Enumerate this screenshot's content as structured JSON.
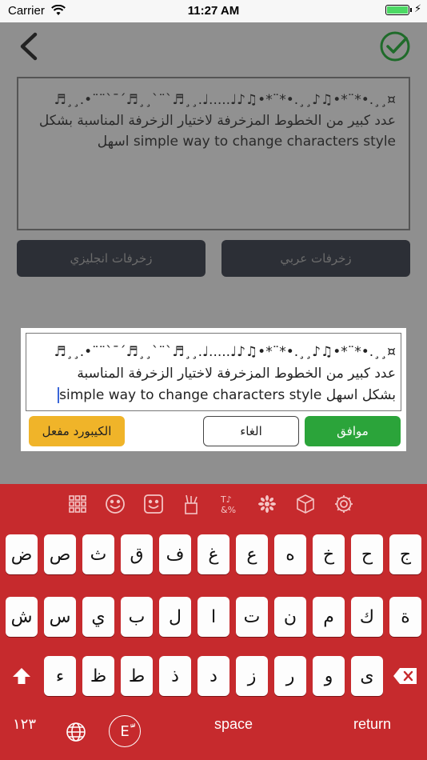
{
  "status": {
    "carrier": "Carrier",
    "time": "11:27 AM"
  },
  "colors": {
    "accent": "#2ba43a",
    "keyboard_bg": "#c62a2d",
    "badge": "#f0b429"
  },
  "preview": {
    "line1": "¤¸¸.•*¨*•♫♪¸¸.•*¨*•♫♪♩.....♩.¸¸♬`¨`¸¸♬´¯`¨¨•.¸¸♬",
    "line2": "عدد كبير من الخطوط المزخرفة لاختيار الزخرفة المناسبة بشكل",
    "line3": "simple way to change characters style اسهل"
  },
  "tabs": {
    "english": "زخرفات انجليزي",
    "arabic": "زخرفات عربي"
  },
  "dialog": {
    "line1": "¤¸¸.•*¨*•♫♪¸¸.•*¨*•♫♪♩.....♩.¸¸♬`¨`¸¸♬´¯`¨¨•.¸¸♬",
    "line2": "عدد كبير من الخطوط المزخرفة لاختيار الزخرفة المناسبة",
    "line3": "بشكل اسهل simple way to change characters style",
    "ok": "موافق",
    "cancel": "الغاء",
    "keyboard_on": "الكيبورد مفعل"
  },
  "toolbar_icons": [
    "grid-icon",
    "emoji-icon",
    "sticker-icon",
    "stationery-icon",
    "symbols-icon",
    "flower-icon",
    "cube-icon",
    "gear-icon"
  ],
  "row1": [
    "ض",
    "ص",
    "ث",
    "ق",
    "ف",
    "غ",
    "ع",
    "ه",
    "خ",
    "ح",
    "ج"
  ],
  "row2": [
    "ش",
    "س",
    "ي",
    "ب",
    "ل",
    "ا",
    "ت",
    "ن",
    "م",
    "ك",
    "ة"
  ],
  "row3": [
    "ء",
    "ظ",
    "ط",
    "ذ",
    "د",
    "ز",
    "ر",
    "و",
    "ى"
  ],
  "bottom": {
    "numbers": "١٢٣",
    "space": "space",
    "return": "return",
    "lang": "Eَّ"
  }
}
